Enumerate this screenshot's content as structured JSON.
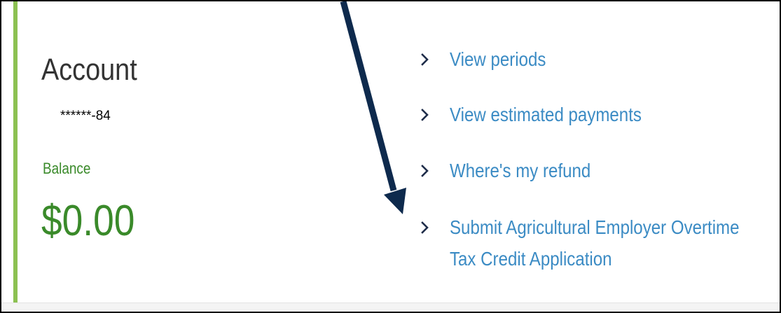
{
  "colors": {
    "accent_bar": "#8cc152",
    "balance_green": "#3a8a2a",
    "link_blue": "#3b8bc4",
    "chevron": "#1f2d4a",
    "arrow": "#0e2a4d"
  },
  "account": {
    "title": "Account",
    "number": "******-84",
    "balance_label": "Balance",
    "balance_value": "$0.00"
  },
  "links": [
    {
      "label": "View periods",
      "icon": "chevron-right-icon"
    },
    {
      "label": "View estimated payments",
      "icon": "chevron-right-icon"
    },
    {
      "label": "Where's my refund",
      "icon": "chevron-right-icon"
    },
    {
      "label": "Submit Agricultural Employer Overtime Tax Credit Application",
      "line1": "Submit Agricultural Employer Overtime",
      "line2": "Tax Credit Application",
      "icon": "chevron-right-icon"
    }
  ],
  "annotation": {
    "icon": "pointer-arrow-icon"
  }
}
